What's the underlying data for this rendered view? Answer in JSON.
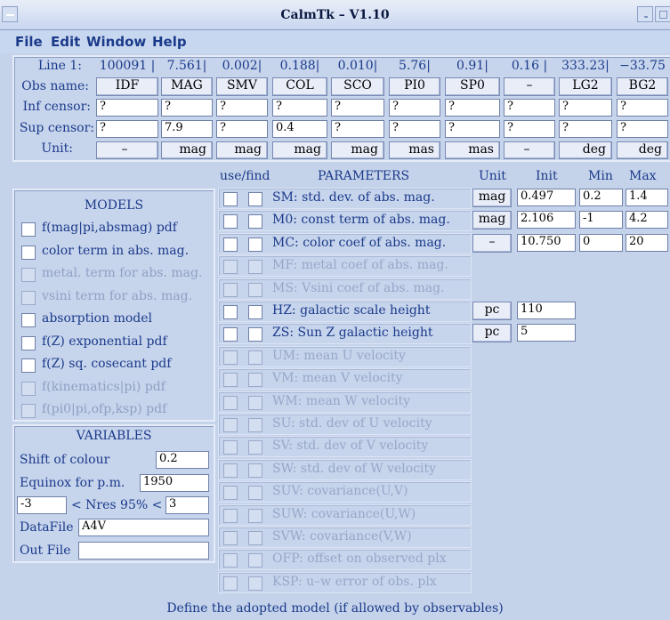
{
  "window": {
    "title": "CalmTk – V1.10"
  },
  "menu": [
    "File",
    "Edit",
    "Window",
    "Help"
  ],
  "observables": {
    "line_label": "Line 1:",
    "obs_label": "Obs name:",
    "inf_label": "Inf censor:",
    "sup_label": "Sup censor:",
    "unit_label": "Unit:",
    "columns": [
      {
        "line": "100091 |",
        "name": "IDF",
        "inf": "?",
        "sup": "?",
        "unit": "–"
      },
      {
        "line": "7.561|",
        "name": "MAG",
        "inf": "?",
        "sup": "7.9",
        "unit": "mag"
      },
      {
        "line": "0.002|",
        "name": "SMV",
        "inf": "?",
        "sup": "?",
        "unit": "mag"
      },
      {
        "line": "0.188|",
        "name": "COL",
        "inf": "?",
        "sup": "0.4",
        "unit": "mag"
      },
      {
        "line": "0.010|",
        "name": "SCO",
        "inf": "?",
        "sup": "?",
        "unit": "mag"
      },
      {
        "line": "5.76|",
        "name": "PI0",
        "inf": "?",
        "sup": "?",
        "unit": "mas"
      },
      {
        "line": "0.91|",
        "name": "SP0",
        "inf": "?",
        "sup": "?",
        "unit": "mas"
      },
      {
        "line": "0.16 |",
        "name": "–",
        "inf": "?",
        "sup": "?",
        "unit": "–"
      },
      {
        "line": "333.23|",
        "name": "LG2",
        "inf": "?",
        "sup": "?",
        "unit": "deg"
      },
      {
        "line": "−33.75",
        "name": "BG2",
        "inf": "?",
        "sup": "?",
        "unit": "deg"
      }
    ]
  },
  "models": {
    "title": "MODELS",
    "items": [
      {
        "label": "f(mag|pi,absmag) pdf",
        "enabled": true
      },
      {
        "label": "color term in abs. mag.",
        "enabled": true
      },
      {
        "label": "metal. term for abs. mag.",
        "enabled": false
      },
      {
        "label": "vsini term for abs. mag.",
        "enabled": false
      },
      {
        "label": "absorption model",
        "enabled": true
      },
      {
        "label": "f(Z) exponential pdf",
        "enabled": true
      },
      {
        "label": "f(Z) sq. cosecant pdf",
        "enabled": true
      },
      {
        "label": "f(kinematics|pi) pdf",
        "enabled": false
      },
      {
        "label": "f(pi0|pi,ofp,ksp) pdf",
        "enabled": false
      }
    ]
  },
  "variables": {
    "title": "VARIABLES",
    "shift_label": "Shift of colour",
    "shift_value": "0.2",
    "equinox_label": "Equinox for p.m.",
    "equinox_value": "1950",
    "nres_min": "-3",
    "nres_label": "< Nres 95% <",
    "nres_max": "3",
    "datafile_label": "DataFile",
    "datafile_value": "A4V",
    "outfile_label": "Out File",
    "outfile_value": ""
  },
  "parameters": {
    "headers": {
      "usefind": "use/find",
      "title": "PARAMETERS",
      "unit": "Unit",
      "init": "Init",
      "min": "Min",
      "max": "Max"
    },
    "rows": [
      {
        "label": "SM:  std. dev. of abs. mag.",
        "enabled": true,
        "unit": "mag",
        "init": "0.497",
        "min": "0.2",
        "max": "1.4"
      },
      {
        "label": "M0:  const term of abs. mag.",
        "enabled": true,
        "unit": "mag",
        "init": "2.106",
        "min": "-1",
        "max": "4.2"
      },
      {
        "label": "MC:  color coef of abs. mag.",
        "enabled": true,
        "unit": "–",
        "init": "10.750",
        "min": "0",
        "max": "20"
      },
      {
        "label": "MF:  metal coef of abs. mag.",
        "enabled": false
      },
      {
        "label": "MS:  Vsini coef of abs. mag.",
        "enabled": false
      },
      {
        "label": "HZ:  galactic scale height",
        "enabled": true,
        "unit": "pc",
        "init": "110"
      },
      {
        "label": "ZS:  Sun Z galactic height",
        "enabled": true,
        "unit": "pc",
        "init": "5"
      },
      {
        "label": "UM:  mean U velocity",
        "enabled": false
      },
      {
        "label": "VM:  mean V velocity",
        "enabled": false
      },
      {
        "label": "WM:  mean W velocity",
        "enabled": false
      },
      {
        "label": "SU:  std. dev of U velocity",
        "enabled": false
      },
      {
        "label": "SV:  std. dev of V velocity",
        "enabled": false
      },
      {
        "label": "SW:  std. dev of W velocity",
        "enabled": false
      },
      {
        "label": "SUV:  covariance(U,V)",
        "enabled": false
      },
      {
        "label": "SUW:  covariance(U,W)",
        "enabled": false
      },
      {
        "label": "SVW:  covariance(V,W)",
        "enabled": false
      },
      {
        "label": "OFP:  offset on observed plx",
        "enabled": false
      },
      {
        "label": "KSP:  u–w error of obs. plx",
        "enabled": false
      }
    ]
  },
  "status": "Define the adopted model (if allowed by observables)"
}
